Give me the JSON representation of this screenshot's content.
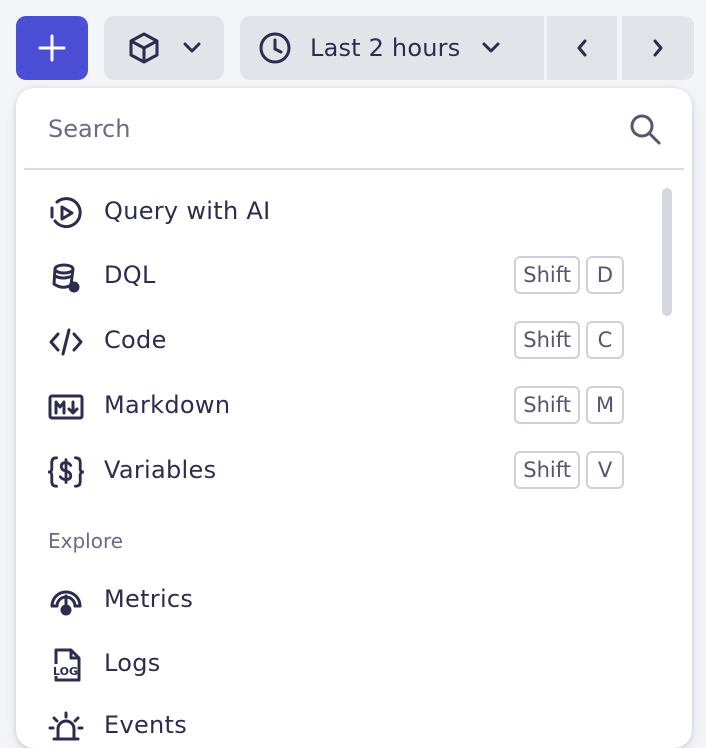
{
  "toolbar": {
    "add_icon": "plus-icon",
    "cube_icon": "cube-icon",
    "time_icon": "clock-icon",
    "time_label": "Last 2 hours",
    "prev_icon": "chevron-left-icon",
    "next_icon": "chevron-right-icon"
  },
  "menu": {
    "search": {
      "placeholder": "Search",
      "value": ""
    },
    "items": [
      {
        "label": "Query with AI",
        "icon": "ai-play-icon",
        "shortcut": []
      },
      {
        "label": "DQL",
        "icon": "dql-icon",
        "shortcut": [
          "Shift",
          "D"
        ]
      },
      {
        "label": "Code",
        "icon": "code-icon",
        "shortcut": [
          "Shift",
          "C"
        ]
      },
      {
        "label": "Markdown",
        "icon": "markdown-icon",
        "shortcut": [
          "Shift",
          "M"
        ]
      },
      {
        "label": "Variables",
        "icon": "variables-icon",
        "shortcut": [
          "Shift",
          "V"
        ]
      }
    ],
    "explore": {
      "title": "Explore",
      "items": [
        {
          "label": "Metrics",
          "icon": "gauge-icon"
        },
        {
          "label": "Logs",
          "icon": "log-file-icon"
        },
        {
          "label": "Events",
          "icon": "alarm-icon"
        }
      ]
    }
  },
  "colors": {
    "accent": "#4b4fd6",
    "text": "#2c2d4d",
    "muted": "#6a6b85",
    "button_bg": "#e3e4ea"
  }
}
